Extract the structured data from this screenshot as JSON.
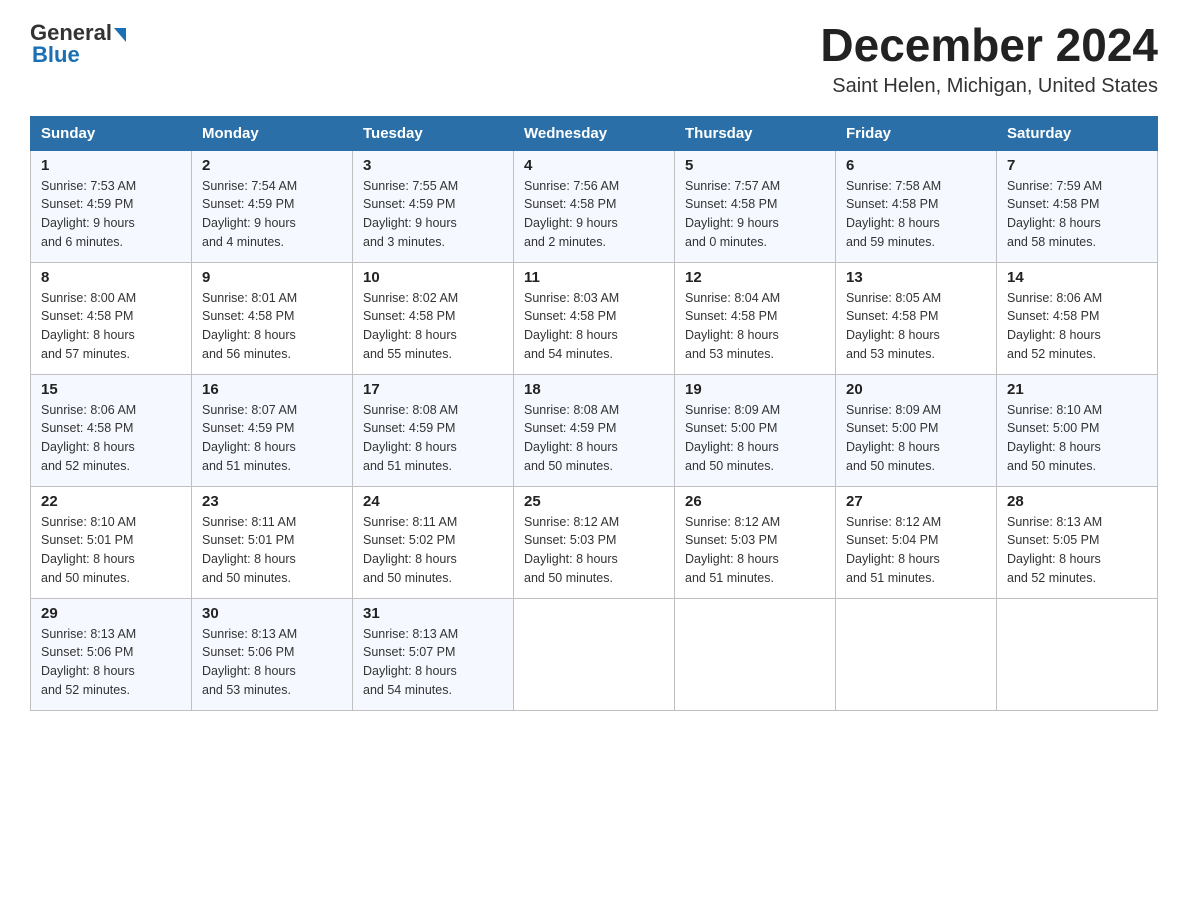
{
  "header": {
    "logo_general": "General",
    "logo_blue": "Blue",
    "month_title": "December 2024",
    "location": "Saint Helen, Michigan, United States"
  },
  "weekdays": [
    "Sunday",
    "Monday",
    "Tuesday",
    "Wednesday",
    "Thursday",
    "Friday",
    "Saturday"
  ],
  "weeks": [
    [
      {
        "day": "1",
        "sunrise": "7:53 AM",
        "sunset": "4:59 PM",
        "daylight": "9 hours and 6 minutes."
      },
      {
        "day": "2",
        "sunrise": "7:54 AM",
        "sunset": "4:59 PM",
        "daylight": "9 hours and 4 minutes."
      },
      {
        "day": "3",
        "sunrise": "7:55 AM",
        "sunset": "4:59 PM",
        "daylight": "9 hours and 3 minutes."
      },
      {
        "day": "4",
        "sunrise": "7:56 AM",
        "sunset": "4:58 PM",
        "daylight": "9 hours and 2 minutes."
      },
      {
        "day": "5",
        "sunrise": "7:57 AM",
        "sunset": "4:58 PM",
        "daylight": "9 hours and 0 minutes."
      },
      {
        "day": "6",
        "sunrise": "7:58 AM",
        "sunset": "4:58 PM",
        "daylight": "8 hours and 59 minutes."
      },
      {
        "day": "7",
        "sunrise": "7:59 AM",
        "sunset": "4:58 PM",
        "daylight": "8 hours and 58 minutes."
      }
    ],
    [
      {
        "day": "8",
        "sunrise": "8:00 AM",
        "sunset": "4:58 PM",
        "daylight": "8 hours and 57 minutes."
      },
      {
        "day": "9",
        "sunrise": "8:01 AM",
        "sunset": "4:58 PM",
        "daylight": "8 hours and 56 minutes."
      },
      {
        "day": "10",
        "sunrise": "8:02 AM",
        "sunset": "4:58 PM",
        "daylight": "8 hours and 55 minutes."
      },
      {
        "day": "11",
        "sunrise": "8:03 AM",
        "sunset": "4:58 PM",
        "daylight": "8 hours and 54 minutes."
      },
      {
        "day": "12",
        "sunrise": "8:04 AM",
        "sunset": "4:58 PM",
        "daylight": "8 hours and 53 minutes."
      },
      {
        "day": "13",
        "sunrise": "8:05 AM",
        "sunset": "4:58 PM",
        "daylight": "8 hours and 53 minutes."
      },
      {
        "day": "14",
        "sunrise": "8:06 AM",
        "sunset": "4:58 PM",
        "daylight": "8 hours and 52 minutes."
      }
    ],
    [
      {
        "day": "15",
        "sunrise": "8:06 AM",
        "sunset": "4:58 PM",
        "daylight": "8 hours and 52 minutes."
      },
      {
        "day": "16",
        "sunrise": "8:07 AM",
        "sunset": "4:59 PM",
        "daylight": "8 hours and 51 minutes."
      },
      {
        "day": "17",
        "sunrise": "8:08 AM",
        "sunset": "4:59 PM",
        "daylight": "8 hours and 51 minutes."
      },
      {
        "day": "18",
        "sunrise": "8:08 AM",
        "sunset": "4:59 PM",
        "daylight": "8 hours and 50 minutes."
      },
      {
        "day": "19",
        "sunrise": "8:09 AM",
        "sunset": "5:00 PM",
        "daylight": "8 hours and 50 minutes."
      },
      {
        "day": "20",
        "sunrise": "8:09 AM",
        "sunset": "5:00 PM",
        "daylight": "8 hours and 50 minutes."
      },
      {
        "day": "21",
        "sunrise": "8:10 AM",
        "sunset": "5:00 PM",
        "daylight": "8 hours and 50 minutes."
      }
    ],
    [
      {
        "day": "22",
        "sunrise": "8:10 AM",
        "sunset": "5:01 PM",
        "daylight": "8 hours and 50 minutes."
      },
      {
        "day": "23",
        "sunrise": "8:11 AM",
        "sunset": "5:01 PM",
        "daylight": "8 hours and 50 minutes."
      },
      {
        "day": "24",
        "sunrise": "8:11 AM",
        "sunset": "5:02 PM",
        "daylight": "8 hours and 50 minutes."
      },
      {
        "day": "25",
        "sunrise": "8:12 AM",
        "sunset": "5:03 PM",
        "daylight": "8 hours and 50 minutes."
      },
      {
        "day": "26",
        "sunrise": "8:12 AM",
        "sunset": "5:03 PM",
        "daylight": "8 hours and 51 minutes."
      },
      {
        "day": "27",
        "sunrise": "8:12 AM",
        "sunset": "5:04 PM",
        "daylight": "8 hours and 51 minutes."
      },
      {
        "day": "28",
        "sunrise": "8:13 AM",
        "sunset": "5:05 PM",
        "daylight": "8 hours and 52 minutes."
      }
    ],
    [
      {
        "day": "29",
        "sunrise": "8:13 AM",
        "sunset": "5:06 PM",
        "daylight": "8 hours and 52 minutes."
      },
      {
        "day": "30",
        "sunrise": "8:13 AM",
        "sunset": "5:06 PM",
        "daylight": "8 hours and 53 minutes."
      },
      {
        "day": "31",
        "sunrise": "8:13 AM",
        "sunset": "5:07 PM",
        "daylight": "8 hours and 54 minutes."
      },
      null,
      null,
      null,
      null
    ]
  ]
}
